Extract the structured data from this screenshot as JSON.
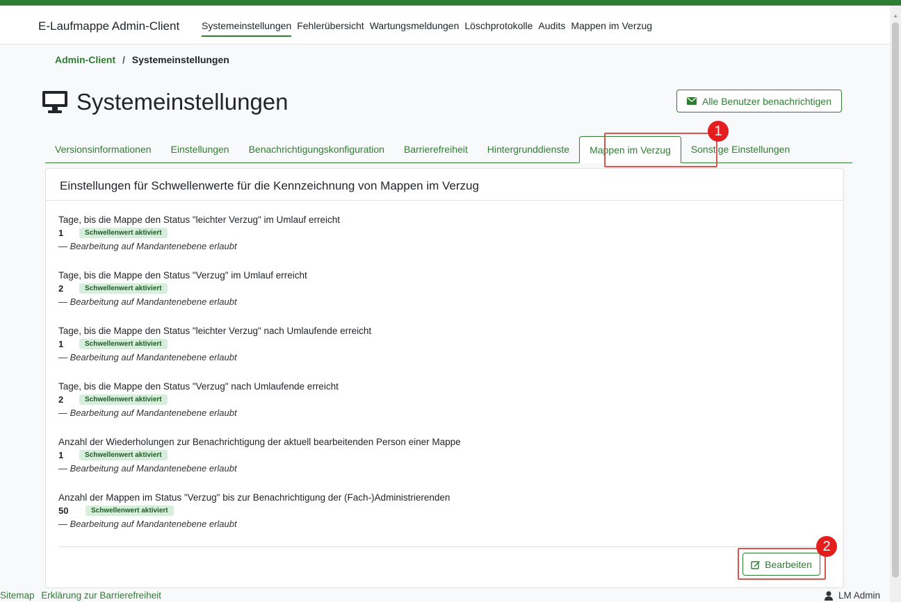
{
  "app": {
    "brand": "E-Laufmappe Admin-Client"
  },
  "nav": [
    "Systemeinstellungen",
    "Fehlerübersicht",
    "Wartungsmeldungen",
    "Löschprotokolle",
    "Audits",
    "Mappen im Verzug"
  ],
  "breadcrumb": {
    "root": "Admin-Client",
    "separator": "/",
    "current": "Systemeinstellungen"
  },
  "page": {
    "title": "Systemeinstellungen",
    "notify_button": "Alle Benutzer benachrichtigen"
  },
  "tabs": [
    "Versionsinformationen",
    "Einstellungen",
    "Benachrichtigungskonfiguration",
    "Barrierefreiheit",
    "Hintergrunddienste",
    "Mappen im Verzug",
    "Sonstige Einstellungen"
  ],
  "card": {
    "title": "Einstellungen für Schwellenwerte für die Kennzeichnung von Mappen im Verzug",
    "items": [
      {
        "label": "Tage, bis die Mappe den Status \"leichter Verzug\" im Umlauf erreicht",
        "value": "1",
        "chip": "Schwellenwert aktiviert",
        "note": "— Bearbeitung auf Mandantenebene erlaubt"
      },
      {
        "label": "Tage, bis die Mappe den Status \"Verzug\" im Umlauf erreicht",
        "value": "2",
        "chip": "Schwellenwert aktiviert",
        "note": "— Bearbeitung auf Mandantenebene erlaubt"
      },
      {
        "label": "Tage, bis die Mappe den Status \"leichter Verzug\" nach Umlaufende erreicht",
        "value": "1",
        "chip": "Schwellenwert aktiviert",
        "note": "— Bearbeitung auf Mandantenebene erlaubt"
      },
      {
        "label": "Tage, bis die Mappe den Status \"Verzug\" nach Umlaufende erreicht",
        "value": "2",
        "chip": "Schwellenwert aktiviert",
        "note": "— Bearbeitung auf Mandantenebene erlaubt"
      },
      {
        "label": "Anzahl der Wiederholungen zur Benachrichtigung der aktuell bearbeitenden Person einer Mappe",
        "value": "1",
        "chip": "Schwellenwert aktiviert",
        "note": "— Bearbeitung auf Mandantenebene erlaubt"
      },
      {
        "label": "Anzahl der Mappen im Status \"Verzug\" bis zur Benachrichtigung der (Fach-)Administrierenden",
        "value": "50",
        "chip": "Schwellenwert aktiviert",
        "note": "— Bearbeitung auf Mandantenebene erlaubt"
      }
    ],
    "edit_button": "Bearbeiten"
  },
  "annotations": {
    "marker1": "1",
    "marker2": "2"
  },
  "footer": {
    "sitemap": "Sitemap",
    "accessibility": "Erklärung zur Barrierefreiheit",
    "user": "LM Admin"
  },
  "colors": {
    "accent": "#2e7d32",
    "marker": "#e41e1e",
    "highlight": "#d9534f"
  }
}
